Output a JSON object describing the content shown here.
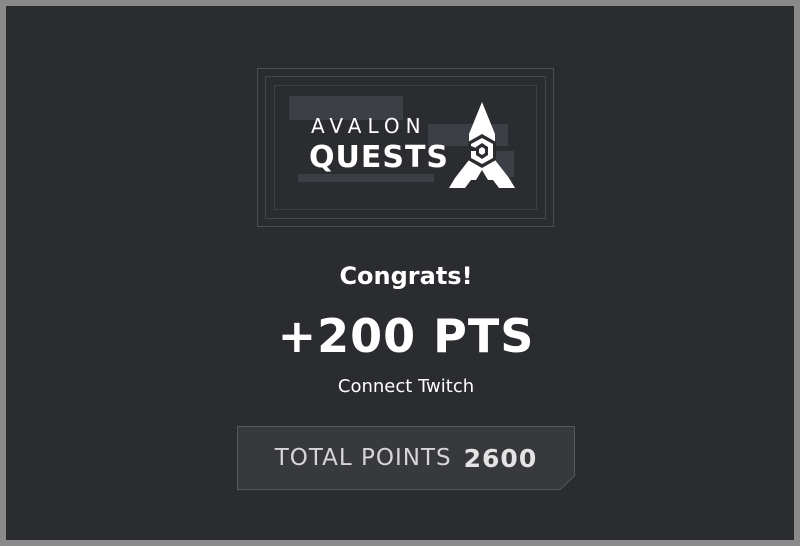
{
  "logo": {
    "line1": "AVALON",
    "line2": "QUESTS",
    "icon": "rocket-logo-icon"
  },
  "result": {
    "heading": "Congrats!",
    "points": "+200 PTS",
    "task": "Connect Twitch"
  },
  "total": {
    "label": "TOTAL POINTS",
    "value": "2600"
  },
  "colors": {
    "background": "#2a2c30",
    "frame": "#8a8a8a",
    "panel": "#36383b",
    "text": "#ffffff"
  }
}
